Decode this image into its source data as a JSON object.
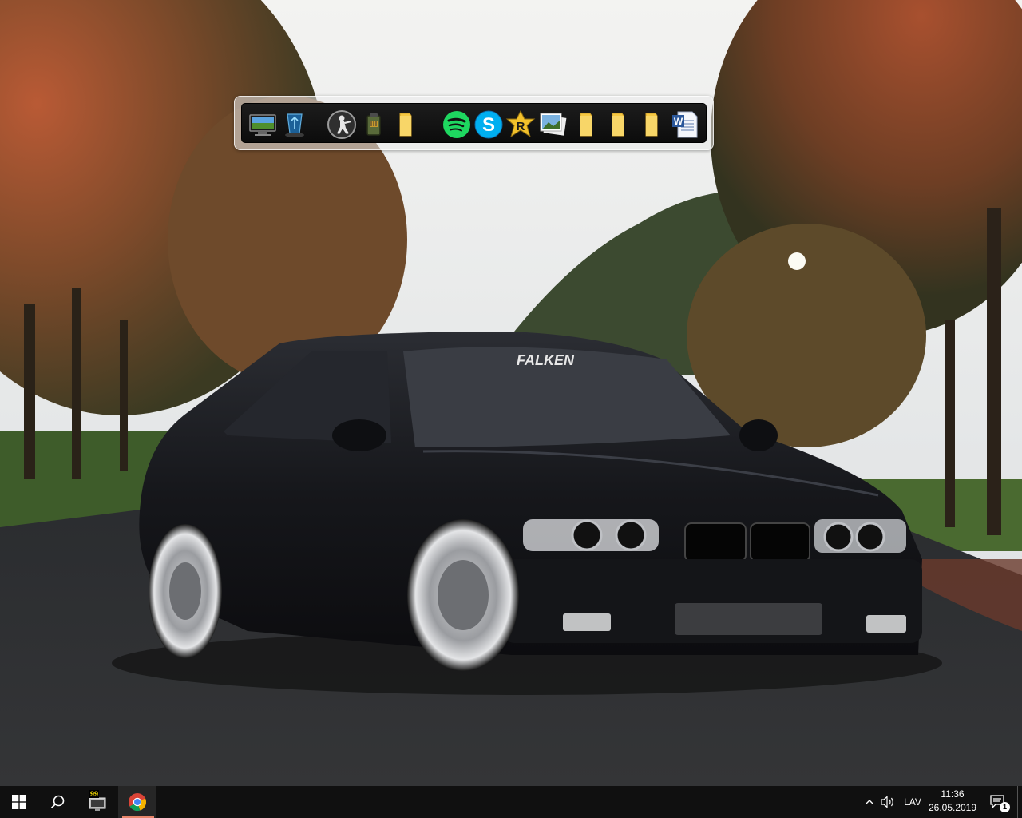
{
  "wallpaper": {
    "windshield_banner": "FALKEN"
  },
  "dock": {
    "icons": [
      {
        "name": "monitor-icon"
      },
      {
        "name": "recycle-bin-icon"
      },
      {
        "name": "counter-strike-icon"
      },
      {
        "name": "pubg-icon"
      },
      {
        "name": "folder-icon"
      },
      {
        "name": "spotify-icon"
      },
      {
        "name": "skype-icon"
      },
      {
        "name": "rockstar-icon"
      },
      {
        "name": "photos-icon"
      },
      {
        "name": "folder-icon"
      },
      {
        "name": "folder-icon"
      },
      {
        "name": "folder-icon"
      },
      {
        "name": "word-document-icon"
      }
    ]
  },
  "taskbar": {
    "pinned_badge": "99",
    "language": "LAV",
    "time": "11:36",
    "date": "26.05.2019",
    "notification_count": "1"
  },
  "colors": {
    "taskbar_bg": "#101010",
    "accent_underline": "#e8856a",
    "spotify_green": "#1ed760",
    "skype_blue": "#00aff0"
  }
}
